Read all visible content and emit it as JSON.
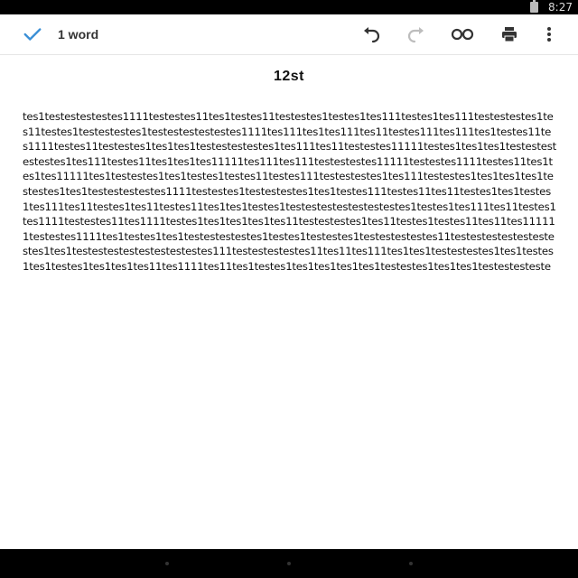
{
  "status_bar": {
    "time": "8:27"
  },
  "toolbar": {
    "word_count": "1 word",
    "icons": [
      "check-icon",
      "undo-icon",
      "redo-icon",
      "view-glasses-icon",
      "print-icon",
      "more-vert-icon"
    ]
  },
  "document": {
    "title": "12st",
    "body": "tes1testestestestes1111testestes11tes1testes11testestes1testes1tes111testes1tes111testestestes1tes11testes1testestestes1testestestestestes1111tes111tes1tes111tes11testes111tes111tes1testes11tes1111testes11testestes1tes1tes1testestestestes1tes111tes11testestes11111testes1tes1tes1testestestestestes1tes111testes11tes1tes1tes11111tes111tes111testestestes11111testestes1111testes11tes1tes1tes11111tes1testestes1tes1testes1testes11testes111testestestes1tes111testestes1tes1tes1tes1testestes1tes1testestestestes1111testestes1testestestes1tes1testes111testes11tes11testes1tes1testes1tes111tes11testes1tes11testes11tes1tes1testes1testestestestestestestes1testes1tes111tes11testes1tes1111testestes11tes1111testes1tes1tes1tes1tes11testestestes1tes11testes1testes11tes11tes111111testestes1111tes1testes1tes1testestestestes1testes1testestes1testestestestes11testestestestestestestes1tes1testestestestestestestestes111testestestestes11tes11tes111tes1tes1testestestes1tes1testes1tes1testes1tes1tes1tes11tes1111tes11tes1testes1tes1tes1tes1tes1testestes1tes1tes1testestesteste"
  }
}
